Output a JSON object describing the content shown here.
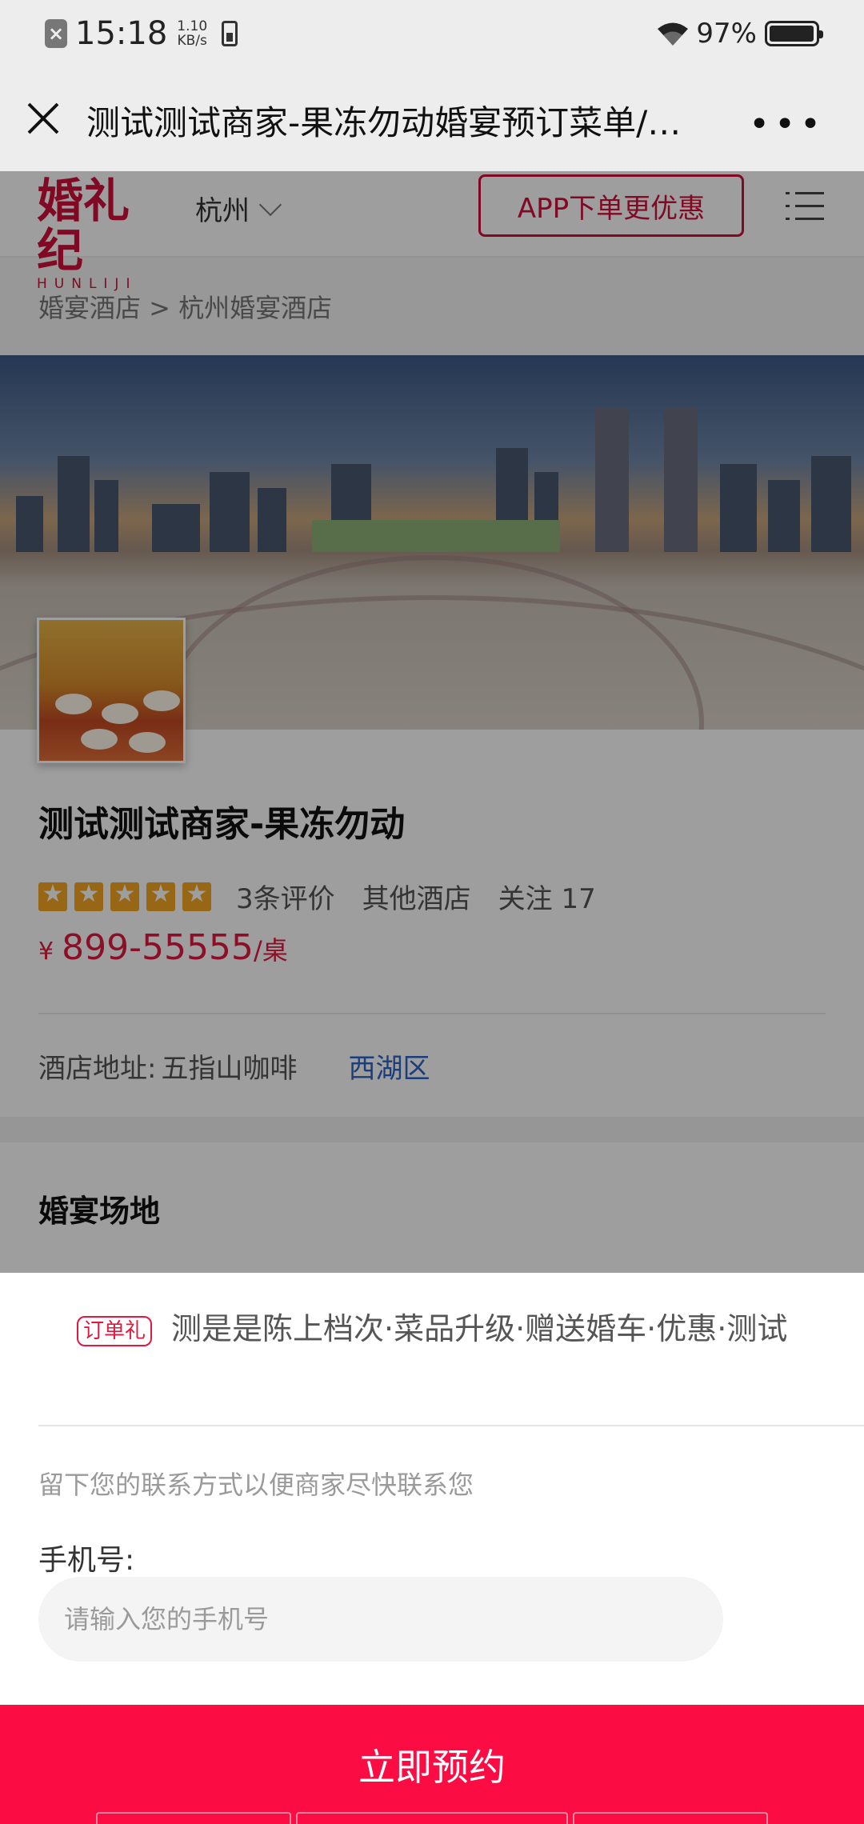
{
  "status_bar": {
    "time": "15:18",
    "speed_value": "1.10",
    "speed_unit": "KB/s",
    "battery": "97%"
  },
  "titlebar": {
    "title": "测试测试商家-果冻勿动婚宴预订菜单/…",
    "more": "•••"
  },
  "header": {
    "logo_cn": "婚礼纪",
    "logo_en": "HUNLIJI",
    "city": "杭州",
    "app_button": "APP下单更优惠"
  },
  "breadcrumb": "婚宴酒店 > 杭州婚宴酒店",
  "hotel": {
    "name": "测试测试商家-果冻勿动",
    "rating_stars": 5,
    "reviews": "3条评价",
    "category": "其他酒店",
    "follow": "关注 17",
    "price_currency": "¥",
    "price_range": "899-55555",
    "price_unit": "/桌",
    "address_label": "酒店地址:",
    "address": "五指山咖啡",
    "district": "西湖区"
  },
  "section": {
    "venue_title": "婚宴场地"
  },
  "sheet": {
    "tag": "订单礼",
    "promo_text": "测是是陈上档次·菜品升级·赠送婚车·优惠·测试",
    "hint": "留下您的联系方式以便商家尽快联系您",
    "phone_label": "手机号:",
    "phone_placeholder": "请输入您的手机号",
    "phone_value": "",
    "book_button": "立即预约"
  },
  "colors": {
    "brand_red": "#d0103a",
    "cta_red": "#fb0c43",
    "price_red": "#e0193f",
    "link_blue": "#2a64c8",
    "star_yellow": "#f5a623"
  }
}
